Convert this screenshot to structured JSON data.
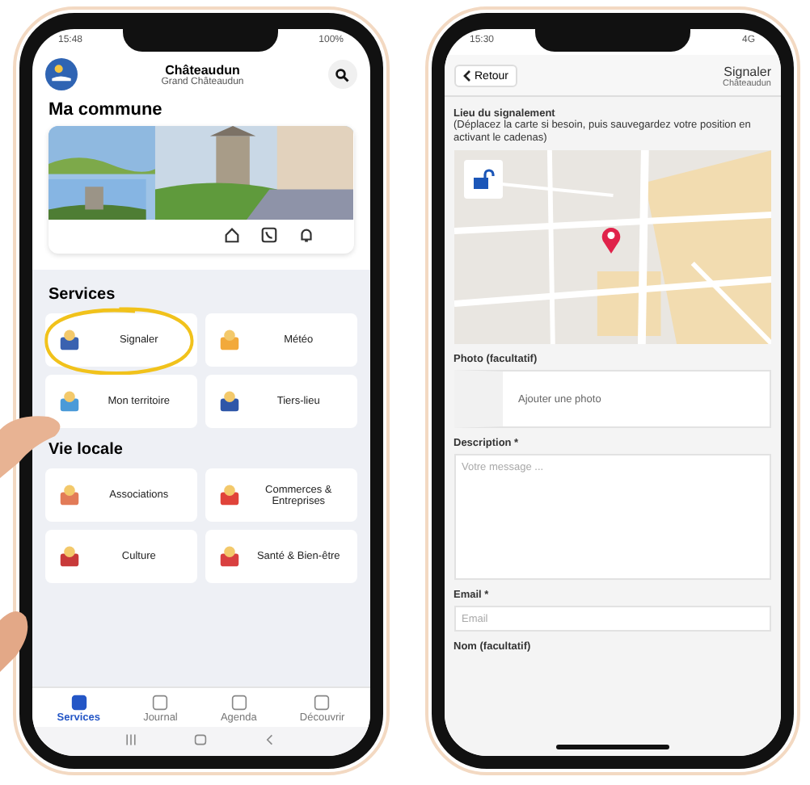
{
  "home_screen": {
    "status_bar": {
      "time": "15:48",
      "battery": "100%"
    },
    "header": {
      "title": "Châteaudun",
      "subtitle": "Grand Châteaudun"
    },
    "commune": {
      "title": "Ma commune"
    },
    "sections": [
      {
        "title": "Services",
        "tiles": [
          {
            "label": "Signaler",
            "circled": true
          },
          {
            "label": "Météo",
            "circled": false
          },
          {
            "label": "Mon territoire",
            "circled": false
          },
          {
            "label": "Tiers-lieu",
            "circled": false
          }
        ]
      },
      {
        "title": "Vie locale",
        "tiles": [
          {
            "label": "Associations",
            "circled": false
          },
          {
            "label": "Commerces & Entreprises",
            "circled": false
          },
          {
            "label": "Culture",
            "circled": false
          },
          {
            "label": "Santé & Bien-être",
            "circled": false
          }
        ]
      }
    ],
    "bottom_nav": [
      {
        "label": "Services",
        "selected": true
      },
      {
        "label": "Journal",
        "selected": false
      },
      {
        "label": "Agenda",
        "selected": false
      },
      {
        "label": "Découvrir",
        "selected": false
      }
    ]
  },
  "report_screen": {
    "status_bar": {
      "time": "15:30",
      "network": "4G"
    },
    "header": {
      "back": "Retour",
      "title": "Signaler",
      "subtitle": "Châteaudun"
    },
    "location": {
      "label": "Lieu du signalement",
      "hint": "(Déplacez la carte si besoin, puis sauvegardez votre position en activant le cadenas)",
      "locked": false
    },
    "photo": {
      "label": "Photo (facultatif)",
      "button": "Ajouter une photo"
    },
    "description": {
      "label": "Description *",
      "placeholder": "Votre message ..."
    },
    "email": {
      "label": "Email *",
      "placeholder": "Email"
    },
    "name": {
      "label": "Nom (facultatif)"
    }
  }
}
